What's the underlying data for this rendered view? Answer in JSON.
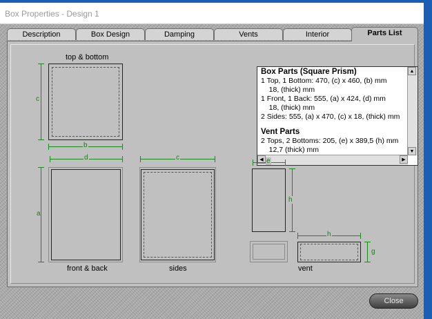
{
  "window": {
    "title": "Box Properties - Design 1"
  },
  "tabs": [
    {
      "label": "Description"
    },
    {
      "label": "Box Design"
    },
    {
      "label": "Damping"
    },
    {
      "label": "Vents"
    },
    {
      "label": "Interior"
    },
    {
      "label": "Parts List"
    }
  ],
  "diagram": {
    "top_bottom_label": "top & bottom",
    "front_back_label": "front & back",
    "sides_label": "sides",
    "vent_label": "vent",
    "dim_a": "a",
    "dim_b": "b",
    "dim_c": "c",
    "dim_d": "d",
    "dim_e": "e",
    "dim_g": "g",
    "dim_h": "h"
  },
  "parts_list": {
    "box_heading": "Box Parts (Square Prism)",
    "box_lines": [
      "1 Top, 1 Bottom:  470, (c) x 460, (b) mm",
      "    18, (thick) mm",
      "1 Front, 1 Back:  555, (a) x 424, (d) mm",
      "    18, (thick) mm",
      "2 Sides:  555, (a) x 470, (c) x 18, (thick) mm"
    ],
    "vent_heading": "Vent Parts",
    "vent_lines": [
      "2 Tops, 2 Bottoms:  205, (e) x 389,5 (h) mm",
      "    12,7 (thick) mm"
    ]
  },
  "buttons": {
    "close": "Close"
  },
  "colors": {
    "dimension_green": "#1a8a1a",
    "titlebar_accent": "#1b5fb5"
  }
}
